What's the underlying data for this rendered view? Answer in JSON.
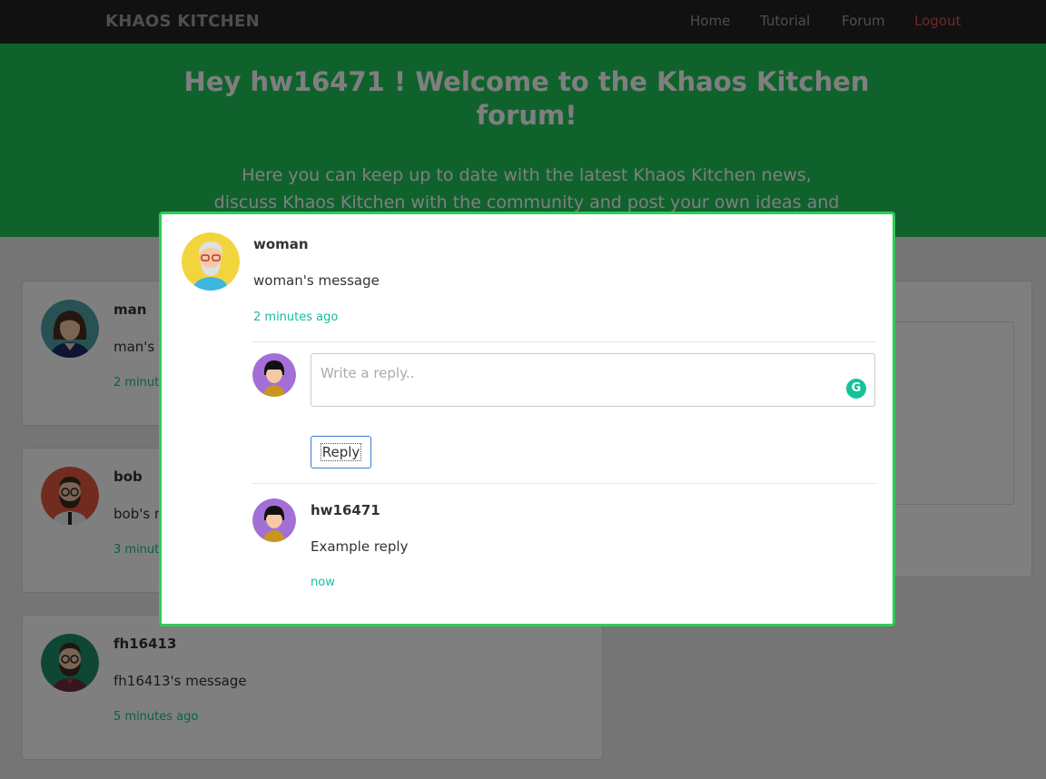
{
  "nav": {
    "brand": "KHAOS KITCHEN",
    "links": [
      "Home",
      "Tutorial",
      "Forum",
      "Logout"
    ]
  },
  "hero": {
    "title": "Hey hw16471 ! Welcome to the Khaos Kitchen forum!",
    "subtitle": "Here you can keep up to date with the latest Khaos Kitchen news, discuss Khaos Kitchen with the community and post your own ideas and issues!"
  },
  "posts": [
    {
      "author": "man",
      "message": "man's message",
      "time": "2 minutes ago",
      "avatar": "woman-avatar-icon"
    },
    {
      "author": "bob",
      "message": "bob's message",
      "time": "3 minutes ago",
      "avatar": "bearded-man-avatar-icon"
    },
    {
      "author": "fh16413",
      "message": "fh16413's message",
      "time": "5 minutes ago",
      "avatar": "hipster-man-avatar-icon"
    }
  ],
  "modal": {
    "post": {
      "author": "woman",
      "message": "woman's message",
      "time": "2 minutes ago",
      "avatar": "old-man-avatar-icon"
    },
    "reply_input": {
      "placeholder": "Write a reply.."
    },
    "reply_button": "Reply",
    "replies": [
      {
        "author": "hw16471",
        "message": "Example reply",
        "time": "now",
        "avatar": "girl-avatar-icon"
      }
    ]
  },
  "colors": {
    "navbar": "#222222",
    "hero": "#21c45b",
    "accent_time": "#18bc9c",
    "logout": "#d9534f",
    "modal_border": "#2ecc55"
  }
}
